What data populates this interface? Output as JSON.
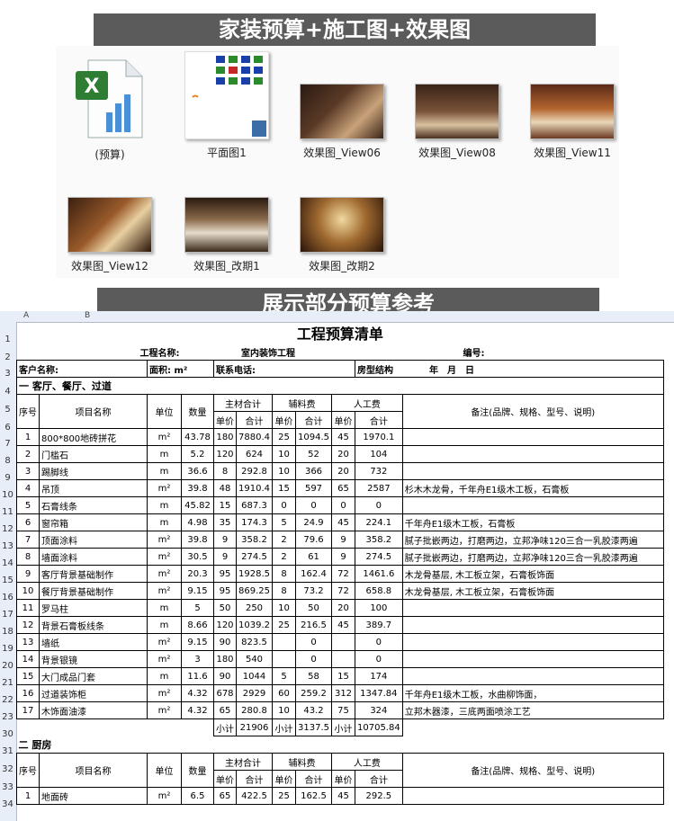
{
  "banners": {
    "top": "家装预算+施工图+效果图",
    "middle": "展示部分预算参考"
  },
  "files": [
    {
      "name": "(预算)",
      "icon": "excel-icon"
    },
    {
      "name": "平面图1",
      "icon": "floor-plan-icon"
    },
    {
      "name": "效果图_View06",
      "icon": "render-image"
    },
    {
      "name": "效果图_View08",
      "icon": "render-image"
    },
    {
      "name": "效果图_View11",
      "icon": "render-image"
    },
    {
      "name": "效果图_View12",
      "icon": "render-image"
    },
    {
      "name": "效果图_改期1",
      "icon": "render-image"
    },
    {
      "name": "效果图_改期2",
      "icon": "render-image"
    }
  ],
  "sheet": {
    "columns": [
      "A",
      "B"
    ],
    "title": "工程预算清单",
    "project_label": "工程名称:",
    "project_value": "室内装饰工程",
    "number_label": "编号:",
    "client_label": "客户名称:",
    "area_label": "面积:",
    "area_unit": "m²",
    "phone_label": "联系电话:",
    "house_label": "房型结构",
    "date_label": "年　月　日",
    "section1": "一 客厅、餐厅、过道",
    "section2": "二 厨房",
    "headers": {
      "seq": "序号",
      "item": "项目名称",
      "unit": "单位",
      "qty": "数量",
      "main": "主材合计",
      "aux": "辅料费",
      "labor": "人工费",
      "price": "单价",
      "total": "合计",
      "note": "备注(品牌、规格、型号、说明)"
    },
    "rows": [
      {
        "rn": "7",
        "seq": "1",
        "item": "800*800地砖拼花",
        "unit": "m²",
        "qty": "43.78",
        "mp": "180",
        "mt": "7880.4",
        "ap": "25",
        "at": "1094.5",
        "lp": "45",
        "lt": "1970.1",
        "note": ""
      },
      {
        "rn": "8",
        "seq": "2",
        "item": "门槛石",
        "unit": "m",
        "qty": "5.2",
        "mp": "120",
        "mt": "624",
        "ap": "10",
        "at": "52",
        "lp": "20",
        "lt": "104",
        "note": ""
      },
      {
        "rn": "9",
        "seq": "3",
        "item": "踢脚线",
        "unit": "m",
        "qty": "36.6",
        "mp": "8",
        "mt": "292.8",
        "ap": "10",
        "at": "366",
        "lp": "20",
        "lt": "732",
        "note": ""
      },
      {
        "rn": "10",
        "seq": "4",
        "item": "吊顶",
        "unit": "m²",
        "qty": "39.8",
        "mp": "48",
        "mt": "1910.4",
        "ap": "15",
        "at": "597",
        "lp": "65",
        "lt": "2587",
        "note": "杉木木龙骨，千年舟E1级木工板，石膏板"
      },
      {
        "rn": "11",
        "seq": "5",
        "item": "石膏线条",
        "unit": "m",
        "qty": "45.82",
        "mp": "15",
        "mt": "687.3",
        "ap": "0",
        "at": "0",
        "lp": "0",
        "lt": "0",
        "note": ""
      },
      {
        "rn": "12",
        "seq": "6",
        "item": "窗帘箱",
        "unit": "m",
        "qty": "4.98",
        "mp": "35",
        "mt": "174.3",
        "ap": "5",
        "at": "24.9",
        "lp": "45",
        "lt": "224.1",
        "note": "千年舟E1级木工板，石膏板"
      },
      {
        "rn": "13",
        "seq": "7",
        "item": "顶面涂料",
        "unit": "m²",
        "qty": "39.8",
        "mp": "9",
        "mt": "358.2",
        "ap": "2",
        "at": "79.6",
        "lp": "9",
        "lt": "358.2",
        "note": "腻子批嵌两边，打磨两边，立邦净味120三合一乳胶漆两遍"
      },
      {
        "rn": "14",
        "seq": "8",
        "item": "墙面涂料",
        "unit": "m²",
        "qty": "30.5",
        "mp": "9",
        "mt": "274.5",
        "ap": "2",
        "at": "61",
        "lp": "9",
        "lt": "274.5",
        "note": "腻子批嵌两边，打磨两边，立邦净味120三合一乳胶漆两遍"
      },
      {
        "rn": "15",
        "seq": "9",
        "item": "客厅背景基础制作",
        "unit": "m²",
        "qty": "20.3",
        "mp": "95",
        "mt": "1928.5",
        "ap": "8",
        "at": "162.4",
        "lp": "72",
        "lt": "1461.6",
        "note": "木龙骨基层, 木工板立架，石膏板饰面"
      },
      {
        "rn": "16",
        "seq": "10",
        "item": "餐厅背景基础制作",
        "unit": "m²",
        "qty": "9.15",
        "mp": "95",
        "mt": "869.25",
        "ap": "8",
        "at": "73.2",
        "lp": "72",
        "lt": "658.8",
        "note": "木龙骨基层, 木工板立架，石膏板饰面"
      },
      {
        "rn": "17",
        "seq": "11",
        "item": "罗马柱",
        "unit": "m",
        "qty": "5",
        "mp": "50",
        "mt": "250",
        "ap": "10",
        "at": "50",
        "lp": "20",
        "lt": "100",
        "note": ""
      },
      {
        "rn": "18",
        "seq": "12",
        "item": "背景石膏板线条",
        "unit": "m",
        "qty": "8.66",
        "mp": "120",
        "mt": "1039.2",
        "ap": "25",
        "at": "216.5",
        "lp": "45",
        "lt": "389.7",
        "note": ""
      },
      {
        "rn": "19",
        "seq": "13",
        "item": "墙纸",
        "unit": "m²",
        "qty": "9.15",
        "mp": "90",
        "mt": "823.5",
        "ap": "",
        "at": "0",
        "lp": "",
        "lt": "0",
        "note": ""
      },
      {
        "rn": "20",
        "seq": "14",
        "item": "背景银镜",
        "unit": "m²",
        "qty": "3",
        "mp": "180",
        "mt": "540",
        "ap": "",
        "at": "0",
        "lp": "",
        "lt": "0",
        "note": ""
      },
      {
        "rn": "21",
        "seq": "15",
        "item": "大门成品门套",
        "unit": "m",
        "qty": "11.6",
        "mp": "90",
        "mt": "1044",
        "ap": "5",
        "at": "58",
        "lp": "15",
        "lt": "174",
        "note": ""
      },
      {
        "rn": "22",
        "seq": "16",
        "item": "过道装饰柜",
        "unit": "m²",
        "qty": "4.32",
        "mp": "678",
        "mt": "2929",
        "ap": "60",
        "at": "259.2",
        "lp": "312",
        "lt": "1347.84",
        "note": "千年舟E1级木工板，水曲柳饰面，"
      },
      {
        "rn": "23",
        "seq": "17",
        "item": "木饰面油漆",
        "unit": "m²",
        "qty": "4.32",
        "mp": "65",
        "mt": "280.8",
        "ap": "10",
        "at": "43.2",
        "lp": "75",
        "lt": "324",
        "note": "立邦木器漆，三底两面喷涂工艺"
      }
    ],
    "subtotal": {
      "label": "小计",
      "main": "21906",
      "aux": "3137.5",
      "labor": "10705.84"
    },
    "kitchen_rows": [
      {
        "rn": "34",
        "seq": "1",
        "item": "地面砖",
        "unit": "m²",
        "qty": "6.5",
        "mp": "65",
        "mt": "422.5",
        "ap": "25",
        "at": "162.5",
        "lp": "45",
        "lt": "292.5",
        "note": ""
      }
    ],
    "row_numbers": {
      "title": "1",
      "project": "2",
      "client": "3",
      "section1": "4",
      "h1": "5",
      "h2": "6",
      "subtotal": "30",
      "section2": "31",
      "kh1": "32",
      "kh2": "33"
    }
  }
}
